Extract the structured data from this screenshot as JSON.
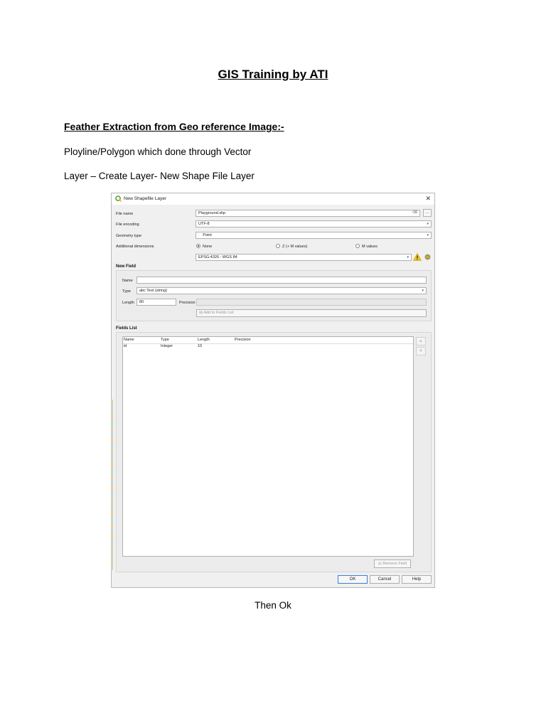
{
  "document": {
    "title": "GIS Training by ATI",
    "section_heading": "Feather Extraction from Geo reference Image:-",
    "paragraph_1": "Ployline/Polygon which done through Vector",
    "paragraph_2": "Layer – Create Layer- New Shape File Layer",
    "caption": "Then Ok"
  },
  "dialog": {
    "title": "New Shapefile Layer",
    "file_name_label": "File name",
    "file_name_value": "Playground.shp",
    "browse_label": "...",
    "file_encoding_label": "File encoding",
    "file_encoding_value": "UTF-8",
    "geometry_type_label": "Geometry type",
    "geometry_type_value": "Point",
    "geometry_type_icon": "point-icon",
    "additional_dimensions_label": "Additional dimensions",
    "dimensions": [
      "None",
      "Z (+ M values)",
      "M values"
    ],
    "selected_dimension": "None",
    "crs_value": "EPSG:4326 - WGS 84",
    "new_field": {
      "heading": "New Field",
      "name_label": "Name",
      "name_value": "",
      "type_label": "Type",
      "type_value": "abc Text (string)",
      "length_label": "Length",
      "length_value": "80",
      "precision_label": "Precision",
      "precision_value": "",
      "add_button": "Add to Fields List"
    },
    "fields_list": {
      "heading": "Fields List",
      "columns": [
        "Name",
        "Type",
        "Length",
        "Precision"
      ],
      "rows": [
        {
          "name": "id",
          "type": "Integer",
          "length": "10",
          "precision": ""
        }
      ],
      "remove_button": "Remove Field"
    },
    "buttons": {
      "ok": "OK",
      "cancel": "Cancel",
      "help": "Help"
    },
    "colors": {
      "qgis_green": "#5fa13b",
      "warning_yellow": "#f5c518",
      "ok_border": "#3c7fd6"
    }
  }
}
